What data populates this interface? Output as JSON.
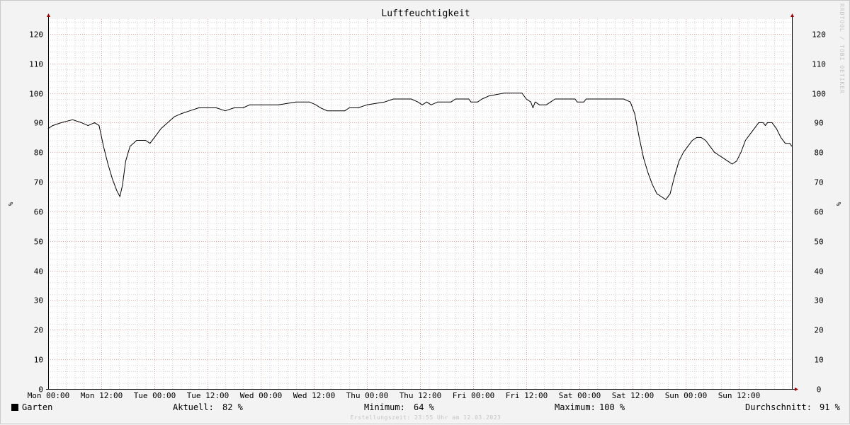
{
  "chart_data": {
    "type": "line",
    "title": "Luftfeuchtigkeit",
    "ylabel": "%",
    "ylabel_right": "%",
    "ylim": [
      0,
      125
    ],
    "yticks": [
      0,
      10,
      20,
      30,
      40,
      50,
      60,
      70,
      80,
      90,
      100,
      110,
      120
    ],
    "xlim_hours": [
      0,
      168
    ],
    "xticks": [
      {
        "h": 0,
        "label": "Mon 00:00"
      },
      {
        "h": 12,
        "label": "Mon 12:00"
      },
      {
        "h": 24,
        "label": "Tue 00:00"
      },
      {
        "h": 36,
        "label": "Tue 12:00"
      },
      {
        "h": 48,
        "label": "Wed 00:00"
      },
      {
        "h": 60,
        "label": "Wed 12:00"
      },
      {
        "h": 72,
        "label": "Thu 00:00"
      },
      {
        "h": 84,
        "label": "Thu 12:00"
      },
      {
        "h": 96,
        "label": "Fri 00:00"
      },
      {
        "h": 108,
        "label": "Fri 12:00"
      },
      {
        "h": 120,
        "label": "Sat 00:00"
      },
      {
        "h": 132,
        "label": "Sat 12:00"
      },
      {
        "h": 144,
        "label": "Sun 00:00"
      },
      {
        "h": 156,
        "label": "Sun 12:00"
      }
    ],
    "grid": true,
    "series": [
      {
        "name": "Garten",
        "color": "#000000",
        "points": [
          [
            0,
            88
          ],
          [
            1,
            89
          ],
          [
            3,
            90
          ],
          [
            5.5,
            91
          ],
          [
            7.5,
            90
          ],
          [
            9,
            89
          ],
          [
            10.5,
            90
          ],
          [
            11.5,
            89
          ],
          [
            12.5,
            82
          ],
          [
            13.5,
            76
          ],
          [
            14.5,
            71
          ],
          [
            15.5,
            67
          ],
          [
            16.2,
            65
          ],
          [
            16.8,
            69
          ],
          [
            17.5,
            77
          ],
          [
            18.5,
            82
          ],
          [
            20,
            84
          ],
          [
            22,
            84
          ],
          [
            23,
            83
          ],
          [
            24,
            85
          ],
          [
            25.5,
            88
          ],
          [
            27,
            90
          ],
          [
            28.5,
            92
          ],
          [
            30,
            93
          ],
          [
            32,
            94
          ],
          [
            34,
            95
          ],
          [
            38,
            95
          ],
          [
            40,
            94
          ],
          [
            42,
            95
          ],
          [
            44,
            95
          ],
          [
            45.5,
            96
          ],
          [
            52,
            96
          ],
          [
            56,
            97
          ],
          [
            59,
            97
          ],
          [
            60.5,
            96
          ],
          [
            61.5,
            95
          ],
          [
            63,
            94
          ],
          [
            67,
            94
          ],
          [
            68,
            95
          ],
          [
            70,
            95
          ],
          [
            72,
            96
          ],
          [
            76,
            97
          ],
          [
            78,
            98
          ],
          [
            82,
            98
          ],
          [
            83.5,
            97
          ],
          [
            84.5,
            96
          ],
          [
            85.5,
            97
          ],
          [
            86.5,
            96
          ],
          [
            88,
            97
          ],
          [
            91,
            97
          ],
          [
            92,
            98
          ],
          [
            95,
            98
          ],
          [
            95.5,
            97
          ],
          [
            97,
            97
          ],
          [
            98,
            98
          ],
          [
            99.5,
            99
          ],
          [
            103,
            100
          ],
          [
            107,
            100
          ],
          [
            108,
            98
          ],
          [
            109,
            97
          ],
          [
            109.5,
            95
          ],
          [
            110,
            97
          ],
          [
            111,
            96
          ],
          [
            112.5,
            96
          ],
          [
            113.5,
            97
          ],
          [
            114.5,
            98
          ],
          [
            119,
            98
          ],
          [
            119.5,
            97
          ],
          [
            121,
            97
          ],
          [
            121.5,
            98
          ],
          [
            130,
            98
          ],
          [
            131.5,
            97
          ],
          [
            132.5,
            93
          ],
          [
            133.5,
            85
          ],
          [
            134.5,
            78
          ],
          [
            135.5,
            73
          ],
          [
            136.5,
            69
          ],
          [
            137.5,
            66
          ],
          [
            138.5,
            65
          ],
          [
            139.5,
            64
          ],
          [
            140.5,
            66
          ],
          [
            141.5,
            72
          ],
          [
            142.5,
            77
          ],
          [
            143.5,
            80
          ],
          [
            144.5,
            82
          ],
          [
            145.5,
            84
          ],
          [
            146.5,
            85
          ],
          [
            147.5,
            85
          ],
          [
            148.5,
            84
          ],
          [
            149.5,
            82
          ],
          [
            150.5,
            80
          ],
          [
            151.5,
            79
          ],
          [
            152.5,
            78
          ],
          [
            153.5,
            77
          ],
          [
            154.5,
            76
          ],
          [
            155.5,
            77
          ],
          [
            156.5,
            80
          ],
          [
            157.5,
            84
          ],
          [
            158.5,
            86
          ],
          [
            159.5,
            88
          ],
          [
            160.5,
            90
          ],
          [
            161.5,
            90
          ],
          [
            162,
            89
          ],
          [
            162.5,
            90
          ],
          [
            163.5,
            90
          ],
          [
            164.5,
            88
          ],
          [
            165.5,
            85
          ],
          [
            166.5,
            83
          ],
          [
            167.5,
            83
          ],
          [
            168,
            82
          ]
        ]
      }
    ]
  },
  "legend": {
    "series_name": "Garten",
    "current_label": "Aktuell:",
    "current_value": "82 %",
    "min_label": "Minimum:",
    "min_value": "64 %",
    "max_label": "Maximum:",
    "max_value": "100 %",
    "avg_label": "Durchschnitt:",
    "avg_value": "91 %"
  },
  "watermark": "RRDTOOL / TOBI OETIKER",
  "footer": "Erstellungszeit: 23:55 Uhr am 12.03.2023",
  "colors": {
    "background": "#f3f3f3",
    "canvas": "#ffffff",
    "minor_grid": "#d6d6d6",
    "major_grid": "#e6a6a6",
    "line": "#000000",
    "axis": "#000000",
    "arrow": "#a00000"
  }
}
